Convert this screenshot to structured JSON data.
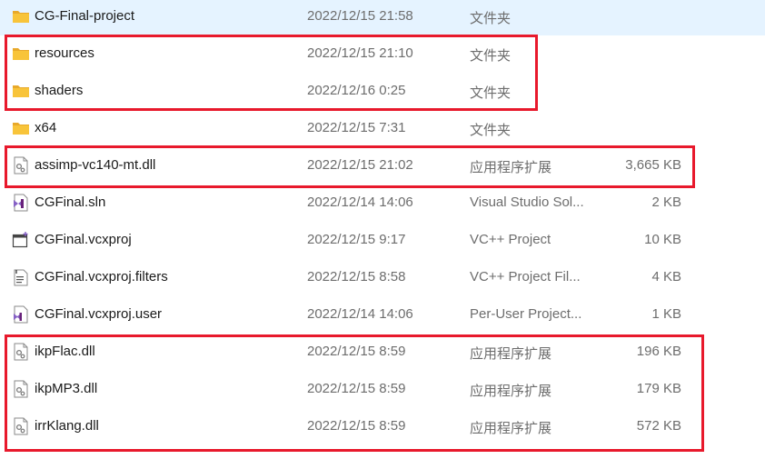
{
  "files": [
    {
      "name": "CG-Final-project",
      "date": "2022/12/15 21:58",
      "type": "文件夹",
      "size": "",
      "icon": "folder-icon"
    },
    {
      "name": "resources",
      "date": "2022/12/15 21:10",
      "type": "文件夹",
      "size": "",
      "icon": "folder-icon"
    },
    {
      "name": "shaders",
      "date": "2022/12/16 0:25",
      "type": "文件夹",
      "size": "",
      "icon": "folder-icon"
    },
    {
      "name": "x64",
      "date": "2022/12/15 7:31",
      "type": "文件夹",
      "size": "",
      "icon": "folder-icon"
    },
    {
      "name": "assimp-vc140-mt.dll",
      "date": "2022/12/15 21:02",
      "type": "应用程序扩展",
      "size": "3,665 KB",
      "icon": "dll-file-icon"
    },
    {
      "name": "CGFinal.sln",
      "date": "2022/12/14 14:06",
      "type": "Visual Studio Sol...",
      "size": "2 KB",
      "icon": "sln-file-icon"
    },
    {
      "name": "CGFinal.vcxproj",
      "date": "2022/12/15 9:17",
      "type": "VC++ Project",
      "size": "10 KB",
      "icon": "vcxproj-file-icon"
    },
    {
      "name": "CGFinal.vcxproj.filters",
      "date": "2022/12/15 8:58",
      "type": "VC++ Project Fil...",
      "size": "4 KB",
      "icon": "filters-file-icon"
    },
    {
      "name": "CGFinal.vcxproj.user",
      "date": "2022/12/14 14:06",
      "type": "Per-User Project...",
      "size": "1 KB",
      "icon": "user-file-icon"
    },
    {
      "name": "ikpFlac.dll",
      "date": "2022/12/15 8:59",
      "type": "应用程序扩展",
      "size": "196 KB",
      "icon": "dll-file-icon"
    },
    {
      "name": "ikpMP3.dll",
      "date": "2022/12/15 8:59",
      "type": "应用程序扩展",
      "size": "179 KB",
      "icon": "dll-file-icon"
    },
    {
      "name": "irrKlang.dll",
      "date": "2022/12/15 8:59",
      "type": "应用程序扩展",
      "size": "572 KB",
      "icon": "dll-file-icon"
    }
  ],
  "colors": {
    "highlight_box": "#e8192c",
    "folder": "#f8c43a",
    "vs_purple": "#8661c5"
  }
}
